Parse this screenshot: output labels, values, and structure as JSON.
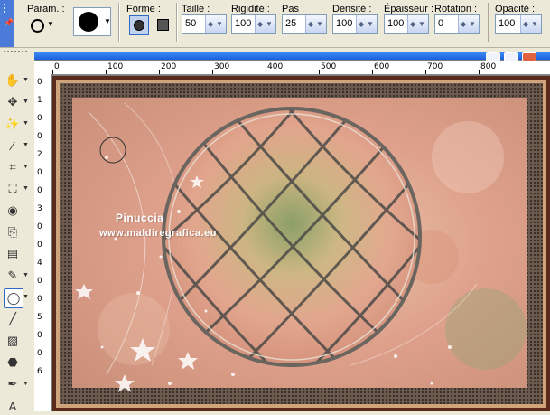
{
  "toolbar": {
    "presets_label": "Param. :",
    "shape_label": "Forme :",
    "fields": [
      {
        "label": "Taille :",
        "value": "50"
      },
      {
        "label": "Rigidité :",
        "value": "100"
      },
      {
        "label": "Pas :",
        "value": "25"
      },
      {
        "label": "Densité :",
        "value": "100"
      },
      {
        "label": "Épaisseur :",
        "value": "100"
      },
      {
        "label": "Rotation :",
        "value": "0"
      },
      {
        "label": "Opacité :",
        "value": "100"
      }
    ]
  },
  "ruler": {
    "h_ticks": [
      "0",
      "100",
      "200",
      "300",
      "400",
      "500",
      "600",
      "700",
      "800"
    ],
    "v_ticks": [
      "0",
      "1",
      "0",
      "0",
      "2",
      "0",
      "0",
      "3",
      "0",
      "0",
      "4",
      "0",
      "0",
      "5",
      "0",
      "0",
      "6"
    ]
  },
  "image": {
    "watermark_line1": "Pinuccia",
    "watermark_line2": "www.maldiregrafica.eu"
  },
  "tools": [
    {
      "name": "pan-tool",
      "glyph": "✋"
    },
    {
      "name": "move-tool",
      "glyph": "✥"
    },
    {
      "name": "magic-wand-tool",
      "glyph": "✨"
    },
    {
      "name": "dropper-tool",
      "glyph": "⁄"
    },
    {
      "name": "crop-tool",
      "glyph": "⌗"
    },
    {
      "name": "deform-tool",
      "glyph": "⛶"
    },
    {
      "name": "red-eye-tool",
      "glyph": "◉"
    },
    {
      "name": "clone-tool",
      "glyph": "⎘"
    },
    {
      "name": "scratch-remover-tool",
      "glyph": "▤"
    },
    {
      "name": "paint-brush-tool",
      "glyph": "✎"
    },
    {
      "name": "eraser-tool",
      "glyph": "◯"
    },
    {
      "name": "lighten-tool",
      "glyph": "╱"
    },
    {
      "name": "retouch-tool",
      "glyph": "▨"
    },
    {
      "name": "flood-fill-tool",
      "glyph": "⬣"
    },
    {
      "name": "pen-tool",
      "glyph": "✒"
    },
    {
      "name": "text-tool",
      "glyph": "A"
    }
  ],
  "colors": {
    "toolbar_bg": "#ece9d8",
    "accent": "#316ac5",
    "frame_dark": "#3a2e27",
    "frame_gold": "#cfa47a",
    "salmon": "#d99b83"
  }
}
